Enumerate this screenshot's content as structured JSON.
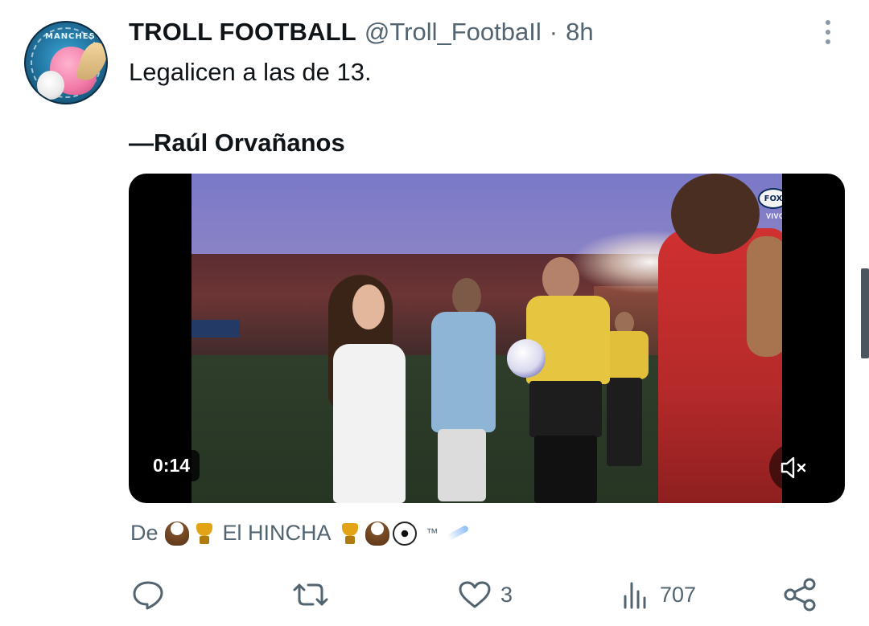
{
  "tweet": {
    "display_name": "TROLL FOOTBALL",
    "handle": "@Troll_FootbaIl",
    "separator": "·",
    "time": "8h",
    "text": "Legalicen a las de 13.",
    "quote_attribution": "—Raúl Orvañanos",
    "avatar": {
      "ring_text": "MANCHESTE"
    }
  },
  "video": {
    "duration": "0:14",
    "overlay_brand": "FOX",
    "overlay_live": "VIVO",
    "mute_icon": "speaker-muted-icon"
  },
  "source": {
    "prefix": "De",
    "name": "El HINCHA",
    "suffix": "™",
    "emoji_left": [
      "eagle",
      "trophy"
    ],
    "emoji_right": [
      "trophy",
      "eagle",
      "soccer-ball"
    ]
  },
  "actions": {
    "reply": {
      "icon": "reply-icon",
      "count": ""
    },
    "retweet": {
      "icon": "retweet-icon",
      "count": ""
    },
    "like": {
      "icon": "heart-icon",
      "count": "3"
    },
    "views": {
      "icon": "views-icon",
      "count": "707"
    },
    "share": {
      "icon": "share-icon",
      "count": ""
    }
  },
  "colors": {
    "text_primary": "#0f1419",
    "text_secondary": "#536471",
    "icon": "#536471"
  }
}
